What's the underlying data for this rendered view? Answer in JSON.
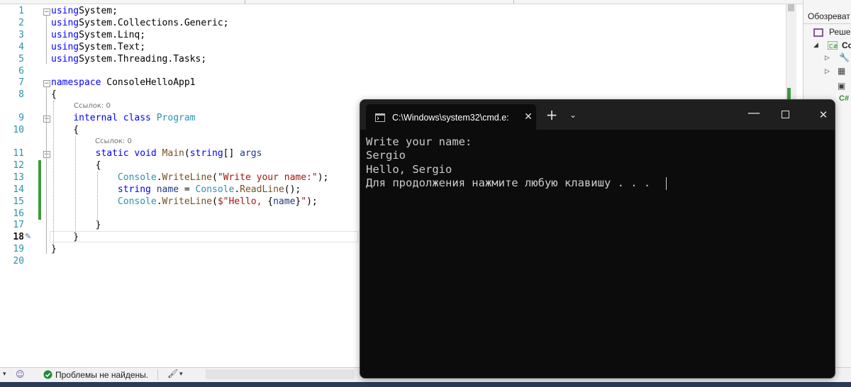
{
  "editor": {
    "lines": [
      {
        "num": "1",
        "tokens": [
          [
            "kw",
            "using"
          ],
          [
            "",
            "System;"
          ]
        ]
      },
      {
        "num": "2",
        "tokens": [
          [
            "kw",
            "using"
          ],
          [
            "",
            "System.Collections.Generic;"
          ]
        ]
      },
      {
        "num": "3",
        "tokens": [
          [
            "kw",
            "using"
          ],
          [
            "",
            "System.Linq;"
          ]
        ]
      },
      {
        "num": "4",
        "tokens": [
          [
            "kw",
            "using"
          ],
          [
            "",
            "System.Text;"
          ]
        ]
      },
      {
        "num": "5",
        "tokens": [
          [
            "kw",
            "using"
          ],
          [
            "",
            "System.Threading.Tasks;"
          ]
        ]
      },
      {
        "num": "6",
        "tokens": []
      },
      {
        "num": "7",
        "tokens": [
          [
            "kw",
            "namespace"
          ],
          [
            "",
            " ConsoleHelloApp1"
          ]
        ]
      },
      {
        "num": "8",
        "tokens": [
          [
            "",
            "{"
          ]
        ]
      },
      {
        "num": "9",
        "tokens": [
          [
            "",
            "    "
          ],
          [
            "kw",
            "internal class"
          ],
          [
            "",
            " "
          ],
          [
            "ty",
            "Program"
          ]
        ]
      },
      {
        "num": "10",
        "tokens": [
          [
            "",
            "    {"
          ]
        ]
      },
      {
        "num": "11",
        "tokens": [
          [
            "",
            "        "
          ],
          [
            "kw",
            "static void"
          ],
          [
            "",
            " "
          ],
          [
            "mt",
            "Main"
          ],
          [
            "",
            "("
          ],
          [
            "kw",
            "string"
          ],
          [
            "",
            "[] "
          ],
          [
            "ref",
            "args"
          ],
          [
            ")"
          ]
        ]
      },
      {
        "num": "12",
        "tokens": [
          [
            "",
            "        {"
          ]
        ]
      },
      {
        "num": "13",
        "tokens": [
          [
            "",
            "            "
          ],
          [
            "ty",
            "Console"
          ],
          [
            "",
            "."
          ],
          [
            "mt",
            "WriteLine"
          ],
          [
            "",
            "("
          ],
          [
            "st",
            "\"Write your name:\""
          ],
          [
            "",
            ");"
          ]
        ]
      },
      {
        "num": "14",
        "tokens": [
          [
            "",
            "            "
          ],
          [
            "kw",
            "string"
          ],
          [
            "",
            " "
          ],
          [
            "ref",
            "name"
          ],
          [
            "",
            " = "
          ],
          [
            "ty",
            "Console"
          ],
          [
            "",
            "."
          ],
          [
            "mt",
            "ReadLine"
          ],
          [
            "",
            "();"
          ]
        ]
      },
      {
        "num": "15",
        "tokens": [
          [
            "",
            "            "
          ],
          [
            "ty",
            "Console"
          ],
          [
            "",
            "."
          ],
          [
            "mt",
            "WriteLine"
          ],
          [
            "",
            "("
          ],
          [
            "st",
            "$\"Hello, "
          ],
          [
            "",
            "{"
          ],
          [
            "ref",
            "name"
          ],
          [
            "",
            "}"
          ],
          [
            "st",
            "\""
          ],
          [
            "",
            ");"
          ]
        ]
      },
      {
        "num": "16",
        "tokens": []
      },
      {
        "num": "17",
        "tokens": [
          [
            "",
            "        }"
          ]
        ]
      },
      {
        "num": "18",
        "tokens": [
          [
            "",
            "    }"
          ]
        ]
      },
      {
        "num": "19",
        "tokens": [
          [
            "",
            "}"
          ]
        ]
      },
      {
        "num": "20",
        "tokens": []
      }
    ],
    "ref_label_class": "Ссылок: 0",
    "ref_label_main": "Ссылок: 0"
  },
  "solution_explorer": {
    "title": "Обозреват",
    "item_solution": "Решен",
    "item_project": "Co",
    "item_cs": "C#"
  },
  "statusbar": {
    "problems": "Проблемы не найдены."
  },
  "cmd": {
    "tab_title": "C:\\Windows\\system32\\cmd.e:",
    "output": [
      "Write your name:",
      "Sergio",
      "Hello, Sergio",
      "Для продолжения нажмите любую клавишу . . ."
    ]
  },
  "colors": {
    "keyword": "#0000ff",
    "type": "#2b91af",
    "string": "#a31515",
    "change_bar": "#3c9b3c",
    "cmd_bg": "#0c0c0c"
  }
}
